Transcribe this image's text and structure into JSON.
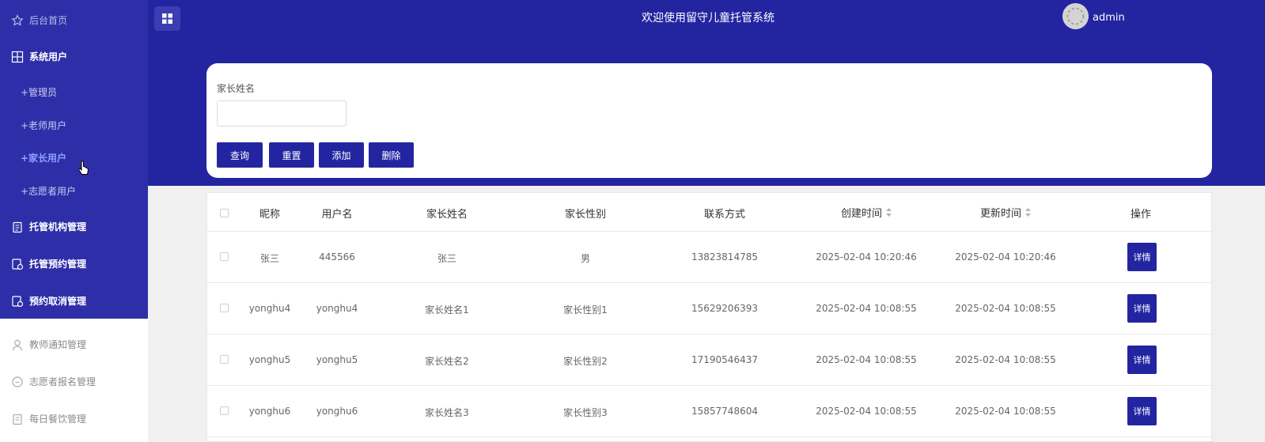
{
  "header": {
    "title": "欢迎使用留守儿童托管系统",
    "username": "admin"
  },
  "sidebar": {
    "items": [
      {
        "label": "后台首页",
        "icon": "star-icon"
      },
      {
        "label": "系统用户",
        "icon": "grid-icon"
      },
      {
        "label": "托管机构管理",
        "icon": "clipboard-icon"
      },
      {
        "label": "托管预约管理",
        "icon": "calendar-icon"
      },
      {
        "label": "预约取消管理",
        "icon": "calendar-icon"
      },
      {
        "label": "教师通知管理",
        "icon": "user-icon"
      },
      {
        "label": "志愿者报名管理",
        "icon": "chat-icon"
      },
      {
        "label": "每日餐饮管理",
        "icon": "clipboard-icon"
      }
    ],
    "subitems": [
      {
        "label": "+管理员"
      },
      {
        "label": "+老师用户"
      },
      {
        "label": "+家长用户"
      },
      {
        "label": "+志愿者用户"
      }
    ]
  },
  "search": {
    "label": "家长姓名",
    "value": "",
    "placeholder": ""
  },
  "buttons": {
    "query": "查询",
    "reset": "重置",
    "add": "添加",
    "delete": "删除"
  },
  "table": {
    "headers": [
      "昵称",
      "用户名",
      "家长姓名",
      "家长性别",
      "联系方式",
      "创建时间",
      "更新时间",
      "操作"
    ],
    "action_label": "详情",
    "rows": [
      [
        "张三",
        "445566",
        "张三",
        "男",
        "13823814785",
        "2025-02-04 10:20:46",
        "2025-02-04 10:20:46"
      ],
      [
        "yonghu4",
        "yonghu4",
        "家长姓名1",
        "家长性别1",
        "15629206393",
        "2025-02-04 10:08:55",
        "2025-02-04 10:08:55"
      ],
      [
        "yonghu5",
        "yonghu5",
        "家长姓名2",
        "家长性别2",
        "17190546437",
        "2025-02-04 10:08:55",
        "2025-02-04 10:08:55"
      ],
      [
        "yonghu6",
        "yonghu6",
        "家长姓名3",
        "家长性别3",
        "15857748604",
        "2025-02-04 10:08:55",
        "2025-02-04 10:08:55"
      ]
    ]
  },
  "colors": {
    "primary": "#2325a0",
    "sidebar": "#2e2fa8",
    "active": "#8fa0ff"
  }
}
